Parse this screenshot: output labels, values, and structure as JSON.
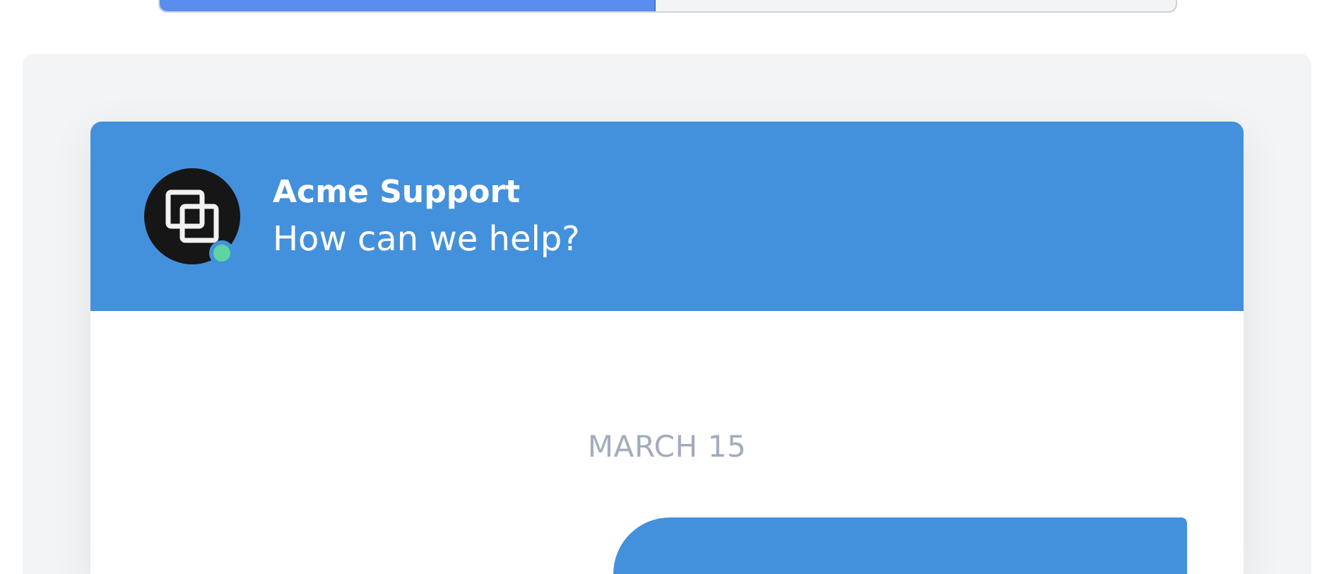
{
  "progress": {
    "level": 0.487
  },
  "chat": {
    "header": {
      "title": "Acme Support",
      "subtitle": "How can we help?",
      "online": true
    },
    "date": "MARCH 15",
    "messages": [
      {
        "kind": "outgoing"
      }
    ]
  }
}
